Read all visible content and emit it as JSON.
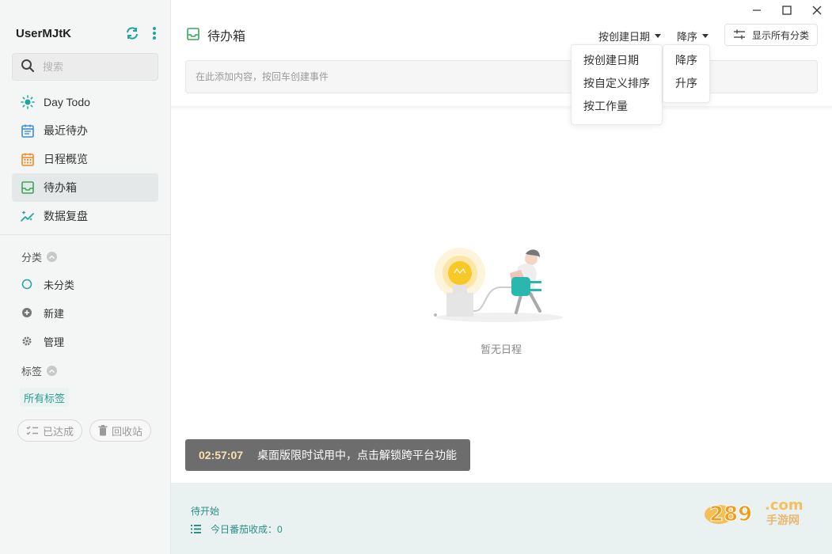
{
  "sidebar": {
    "username": "UserMJtK",
    "search_placeholder": "搜索",
    "nav": [
      {
        "label": "Day Todo",
        "icon": "sun-icon"
      },
      {
        "label": "最近待办",
        "icon": "calendar-list-icon"
      },
      {
        "label": "日程概览",
        "icon": "calendar-grid-icon"
      },
      {
        "label": "待办箱",
        "icon": "inbox-icon",
        "active": true
      },
      {
        "label": "数据复盘",
        "icon": "sparkle-chart-icon"
      }
    ],
    "category_title": "分类",
    "categories": [
      {
        "label": "未分类",
        "icon": "circle-outline-icon"
      },
      {
        "label": "新建",
        "icon": "plus-circle-icon"
      },
      {
        "label": "管理",
        "icon": "gear-icon"
      }
    ],
    "tag_title": "标签",
    "all_tags": "所有标签",
    "done_label": "已达成",
    "trash_label": "回收站"
  },
  "header": {
    "title": "待办箱",
    "sort_by": "按创建日期",
    "order": "降序",
    "show_all": "显示所有分类"
  },
  "add_input_placeholder": "在此添加内容，按回车创建事件",
  "sort_menu": [
    "按创建日期",
    "按自定义排序",
    "按工作量"
  ],
  "order_menu": [
    "降序",
    "升序"
  ],
  "empty_text": "暂无日程",
  "toast": {
    "time": "02:57:07",
    "message": "桌面版限时试用中，点击解锁跨平台功能"
  },
  "footer": {
    "status": "待开始",
    "pomodoro": "今日番茄收成：0"
  },
  "colors": {
    "accent": "#2a9d8f",
    "sun": "#1fa5a0",
    "calendar_list": "#3b8fd6",
    "calendar_grid": "#f08a24",
    "inbox": "#3aa657"
  }
}
